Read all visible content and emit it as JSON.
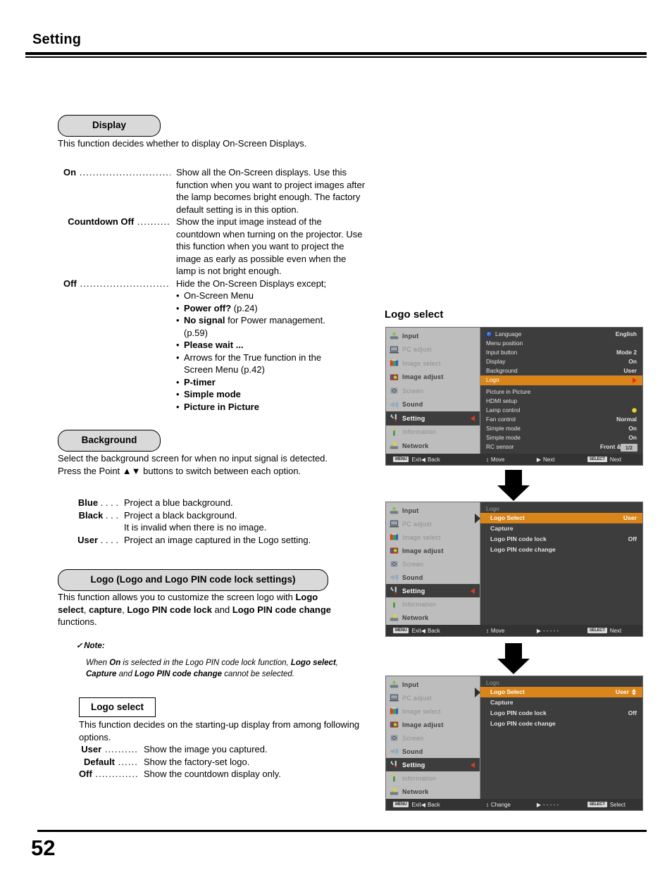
{
  "header": {
    "title": "Setting"
  },
  "page_number": "52",
  "sections": {
    "display": {
      "pill_label": "Display",
      "intro": "This function decides whether to display On-Screen Displays.",
      "options": [
        {
          "term": "On",
          "desc": "Show all the On-Screen displays. Use this function when you want to project images after the lamp becomes bright enough. The factory default setting is in this option."
        },
        {
          "term": "Countdown Off",
          "desc": "Show the input image instead of the countdown when turning on the projector. Use this function when you want to project the image as early as possible even when the lamp is not bright enough."
        },
        {
          "term": "Off",
          "desc": "Hide the On-Screen Displays except;"
        }
      ],
      "off_exceptions": [
        {
          "text": "On-Screen Menu",
          "bold": "",
          "bullet": true
        },
        {
          "text": " (p.24)",
          "bold": "Power off?",
          "bullet": true
        },
        {
          "text": " for Power management.",
          "bold": "No signal",
          "bullet": true
        },
        {
          "text": "(p.59)",
          "bold": "",
          "bullet": false
        },
        {
          "text": "",
          "bold": "Please wait ...",
          "bullet": true
        },
        {
          "text": "Arrows for the True function in the",
          "bold": "",
          "bullet": true
        },
        {
          "text": "Screen Menu (p.42)",
          "bold": "",
          "bullet": false
        },
        {
          "text": "",
          "bold": "P-timer",
          "bullet": true
        },
        {
          "text": "",
          "bold": "Simple mode",
          "bullet": true
        },
        {
          "text": "",
          "bold": "Picture in Picture",
          "bullet": true
        }
      ]
    },
    "background": {
      "pill_label": "Background",
      "intro_line1": "Select the background screen for when no input signal is detected.",
      "intro_line2_pre": "Press the Point ",
      "intro_line2_arrows": "▲▼",
      "intro_line2_post": " buttons to switch between each option.",
      "options": [
        {
          "term": "Blue",
          "dots": ". . . .",
          "desc": "Project a blue background.",
          "cont": ""
        },
        {
          "term": "Black",
          "dots": ". . .",
          "desc": "Project a black background.",
          "cont": "It is invalid when there is no image."
        },
        {
          "term": "User",
          "dots": ". . . .",
          "desc": "Project an image captured in the Logo setting.",
          "cont": ""
        }
      ]
    },
    "logo": {
      "pill_label": "Logo (Logo and Logo PIN code lock settings)",
      "intro_parts": [
        {
          "t": "This function allows you to customize the screen logo with ",
          "b": false
        },
        {
          "t": "Logo select",
          "b": true
        },
        {
          "t": ", ",
          "b": false
        },
        {
          "t": "capture",
          "b": true
        },
        {
          "t": ", ",
          "b": false
        },
        {
          "t": "Logo PIN code lock",
          "b": true
        },
        {
          "t": " and ",
          "b": false
        },
        {
          "t": "Logo PIN code change",
          "b": true
        },
        {
          "t": " functions.",
          "b": false
        }
      ],
      "note_check": "✓",
      "note_title": "Note:",
      "note_parts": [
        {
          "t": "When ",
          "b": false
        },
        {
          "t": "On",
          "b": true
        },
        {
          "t": " is selected in the Logo PIN code lock function, ",
          "b": false
        },
        {
          "t": "Logo select",
          "b": true
        },
        {
          "t": ", ",
          "b": false
        },
        {
          "t": "Capture",
          "b": true
        },
        {
          "t": " and ",
          "b": false
        },
        {
          "t": "Logo PIN code change",
          "b": true
        },
        {
          "t": " cannot be selected.",
          "b": false
        }
      ]
    },
    "logo_select": {
      "box_label": "Logo select",
      "intro": "This function decides on the starting-up display from among following options.",
      "options": [
        {
          "term": "User",
          "desc": "Show the image you captured."
        },
        {
          "term": "Default",
          "desc": "Show the factory-set logo."
        },
        {
          "term": "Off",
          "desc": "Show the countdown display only."
        }
      ]
    }
  },
  "osd": {
    "heading": "Logo select",
    "sidebar": [
      {
        "label": "Input",
        "icon": "input-icon",
        "state": "lit"
      },
      {
        "label": "PC adjust",
        "icon": "pc-adjust-icon",
        "state": "dim"
      },
      {
        "label": "Image select",
        "icon": "image-select-icon",
        "state": "dim"
      },
      {
        "label": "Image adjust",
        "icon": "image-adjust-icon",
        "state": "lit"
      },
      {
        "label": "Screen",
        "icon": "screen-icon",
        "state": "dim"
      },
      {
        "label": "Sound",
        "icon": "sound-icon",
        "state": "lit"
      },
      {
        "label": "Setting",
        "icon": "setting-icon",
        "state": "active"
      },
      {
        "label": "Information",
        "icon": "information-icon",
        "state": "dim"
      },
      {
        "label": "Network",
        "icon": "network-icon",
        "state": "lit"
      }
    ],
    "menu1": {
      "rows": [
        {
          "label": "Language",
          "value": "English",
          "globe": true
        },
        {
          "label": "Menu position",
          "value": ""
        },
        {
          "label": "Input button",
          "value": "Mode 2"
        },
        {
          "label": "Display",
          "value": "On"
        },
        {
          "label": "Background",
          "value": "User"
        },
        {
          "label": "Logo",
          "value": "",
          "highlight": true,
          "arrow": true
        },
        {
          "label": "Picture in Picture",
          "value": ""
        },
        {
          "label": "HDMI setup",
          "value": ""
        },
        {
          "label": "Lamp control",
          "value": "",
          "lamp": true
        },
        {
          "label": "Fan control",
          "value": "Normal"
        },
        {
          "label": "Simple mode",
          "value": "On"
        },
        {
          "label": "Simple mode",
          "value": "On"
        },
        {
          "label": "RC sensor",
          "value": "Front & Back"
        }
      ],
      "page_chip": "1/2",
      "status": [
        {
          "key": "MENU",
          "glyph": "",
          "label": "Exit"
        },
        {
          "key": "",
          "glyph": "◀",
          "label": "Back"
        },
        {
          "key": "",
          "glyph": "↕",
          "label": "Move"
        },
        {
          "key": "",
          "glyph": "▶",
          "label": "Next"
        },
        {
          "key": "SELECT",
          "glyph": "",
          "label": "Next"
        }
      ]
    },
    "menu2": {
      "panel_title": "Logo",
      "rows": [
        {
          "label": "Logo Select",
          "value": "User",
          "highlight": true,
          "pointer": true
        },
        {
          "label": "Capture",
          "value": ""
        },
        {
          "label": "Logo PIN code lock",
          "value": "Off"
        },
        {
          "label": "Logo PIN code change",
          "value": ""
        }
      ],
      "status": [
        {
          "key": "MENU",
          "glyph": "",
          "label": "Exit"
        },
        {
          "key": "",
          "glyph": "◀",
          "label": "Back"
        },
        {
          "key": "",
          "glyph": "↕",
          "label": "Move"
        },
        {
          "key": "",
          "glyph": "▶",
          "label": "- - - - -"
        },
        {
          "key": "SELECT",
          "glyph": "",
          "label": "Next"
        }
      ]
    },
    "menu3": {
      "panel_title": "Logo",
      "rows": [
        {
          "label": "Logo Select",
          "value": "User",
          "highlight": true,
          "pointer": true,
          "updown": true
        },
        {
          "label": "Capture",
          "value": ""
        },
        {
          "label": "Logo PIN code lock",
          "value": "Off"
        },
        {
          "label": "Logo PIN code change",
          "value": ""
        }
      ],
      "status": [
        {
          "key": "MENU",
          "glyph": "",
          "label": "Exit"
        },
        {
          "key": "",
          "glyph": "◀",
          "label": "Back"
        },
        {
          "key": "",
          "glyph": "↕",
          "label": "Change"
        },
        {
          "key": "",
          "glyph": "▶",
          "label": "- - - - -"
        },
        {
          "key": "SELECT",
          "glyph": "",
          "label": "Select"
        }
      ]
    }
  },
  "colors": {
    "highlight": "#d98519",
    "panel_bg": "#3d3d3d",
    "sidebar_bg": "#bdbdbd",
    "arrow_red": "#e03a20",
    "pill_bg": "#d9d9d9"
  }
}
